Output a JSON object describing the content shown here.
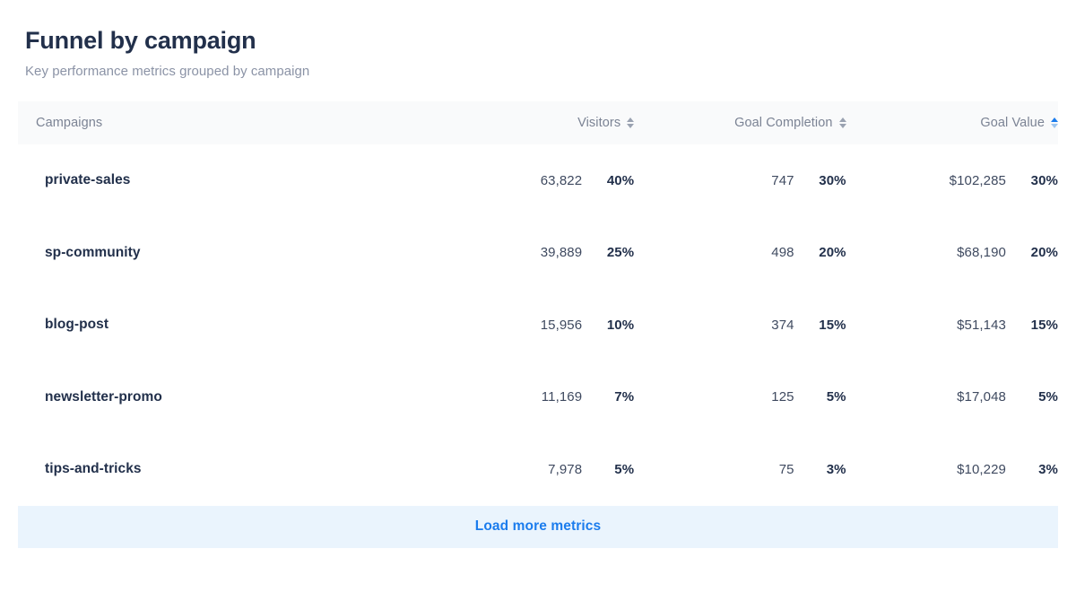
{
  "panel": {
    "title": "Funnel by campaign",
    "subtitle": "Key performance metrics grouped by campaign"
  },
  "table": {
    "columns": [
      {
        "key": "campaigns",
        "label": "Campaigns",
        "sortable": false,
        "sort_state": "none"
      },
      {
        "key": "visitors",
        "label": "Visitors",
        "sortable": true,
        "sort_state": "none"
      },
      {
        "key": "goal_completion",
        "label": "Goal Completion",
        "sortable": true,
        "sort_state": "none"
      },
      {
        "key": "goal_value",
        "label": "Goal Value",
        "sortable": true,
        "sort_state": "asc"
      }
    ],
    "rows": [
      {
        "campaign": "private-sales",
        "visitors": "63,822",
        "visitors_pct": "40%",
        "goal_completion": "747",
        "goal_completion_pct": "30%",
        "goal_value": "$102,285",
        "goal_value_pct": "30%"
      },
      {
        "campaign": "sp-community",
        "visitors": "39,889",
        "visitors_pct": "25%",
        "goal_completion": "498",
        "goal_completion_pct": "20%",
        "goal_value": "$68,190",
        "goal_value_pct": "20%"
      },
      {
        "campaign": "blog-post",
        "visitors": "15,956",
        "visitors_pct": "10%",
        "goal_completion": "374",
        "goal_completion_pct": "15%",
        "goal_value": "$51,143",
        "goal_value_pct": "15%"
      },
      {
        "campaign": "newsletter-promo",
        "visitors": "11,169",
        "visitors_pct": "7%",
        "goal_completion": "125",
        "goal_completion_pct": "5%",
        "goal_value": "$17,048",
        "goal_value_pct": "5%"
      },
      {
        "campaign": "tips-and-tricks",
        "visitors": "7,978",
        "visitors_pct": "5%",
        "goal_completion": "75",
        "goal_completion_pct": "3%",
        "goal_value": "$10,229",
        "goal_value_pct": "3%"
      }
    ],
    "footer": {
      "load_more_label": "Load more metrics"
    }
  },
  "colors": {
    "heading": "#22304b",
    "muted": "#8b93a6",
    "accent": "#1b7ced",
    "header_row_bg": "#f9fafb",
    "footer_bg": "#eaf4fd",
    "sort_inactive": "#9aa2b1"
  }
}
